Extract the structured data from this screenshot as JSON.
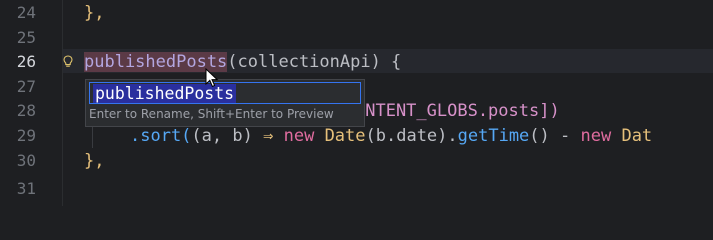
{
  "gutter": {
    "line_numbers": [
      "24",
      "25",
      "26",
      "27",
      "28",
      "29",
      "30",
      "31"
    ],
    "current_line": "26"
  },
  "code": {
    "line24": "},",
    "line26_name": "publishedPosts",
    "line26_rest": "(collectionApi) {",
    "line28_tail": "ONTENT_GLOBS.posts])",
    "line29_a": ".sort(",
    "line29_b": "(a, b)",
    "line29_arrow": "⇒",
    "line29_new1": "new",
    "line29_date1": "Date",
    "line29_c": "(b.date).",
    "line29_gettime": "getTime",
    "line29_d": "() - ",
    "line29_new2": "new",
    "line29_date2": "Dat",
    "line30": "},"
  },
  "rename_popup": {
    "value": "publishedPosts",
    "hint": "Enter to Rename, Shift+Enter to Preview"
  },
  "colors": {
    "background": "#1e1f22",
    "rename_highlight": "#5b3a46",
    "input_border": "#3574f0",
    "selection": "#2a2f9e"
  },
  "icons": {
    "intention": "lightbulb-icon",
    "cursor": "mouse-pointer-icon"
  }
}
